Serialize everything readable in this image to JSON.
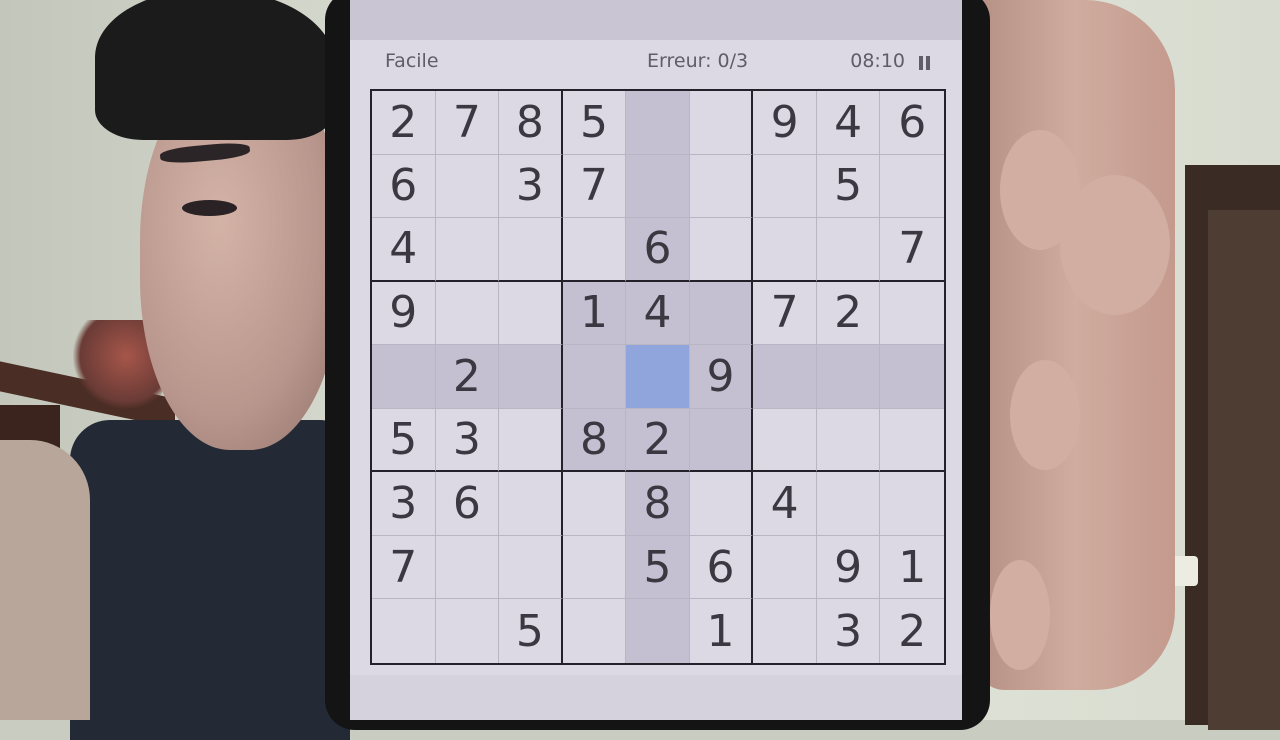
{
  "header": {
    "difficulty": "Facile",
    "errors": "Erreur: 0/3",
    "timer": "08:10"
  },
  "board": {
    "selected": [
      4,
      4
    ],
    "rows": [
      [
        "2",
        "7",
        "8",
        "5",
        "",
        "",
        "9",
        "4",
        "6"
      ],
      [
        "6",
        "",
        "3",
        "7",
        "",
        "",
        "",
        "5",
        ""
      ],
      [
        "4",
        "",
        "",
        "",
        "6",
        "",
        "",
        "",
        "7"
      ],
      [
        "9",
        "",
        "",
        "1",
        "4",
        "",
        "7",
        "2",
        ""
      ],
      [
        "",
        "2",
        "",
        "",
        "",
        "9",
        "",
        "",
        ""
      ],
      [
        "5",
        "3",
        "",
        "8",
        "2",
        "",
        "",
        "",
        ""
      ],
      [
        "3",
        "6",
        "",
        "",
        "8",
        "",
        "4",
        "",
        ""
      ],
      [
        "7",
        "",
        "",
        "",
        "5",
        "6",
        "",
        "9",
        "1"
      ],
      [
        "",
        "",
        "5",
        "",
        "",
        "1",
        "",
        "3",
        "2"
      ]
    ]
  },
  "colors": {
    "highlight": "#c4c0d2",
    "selected": "#8fa5dc",
    "grid": "#232129"
  },
  "icons": [
    "pause-icon"
  ]
}
